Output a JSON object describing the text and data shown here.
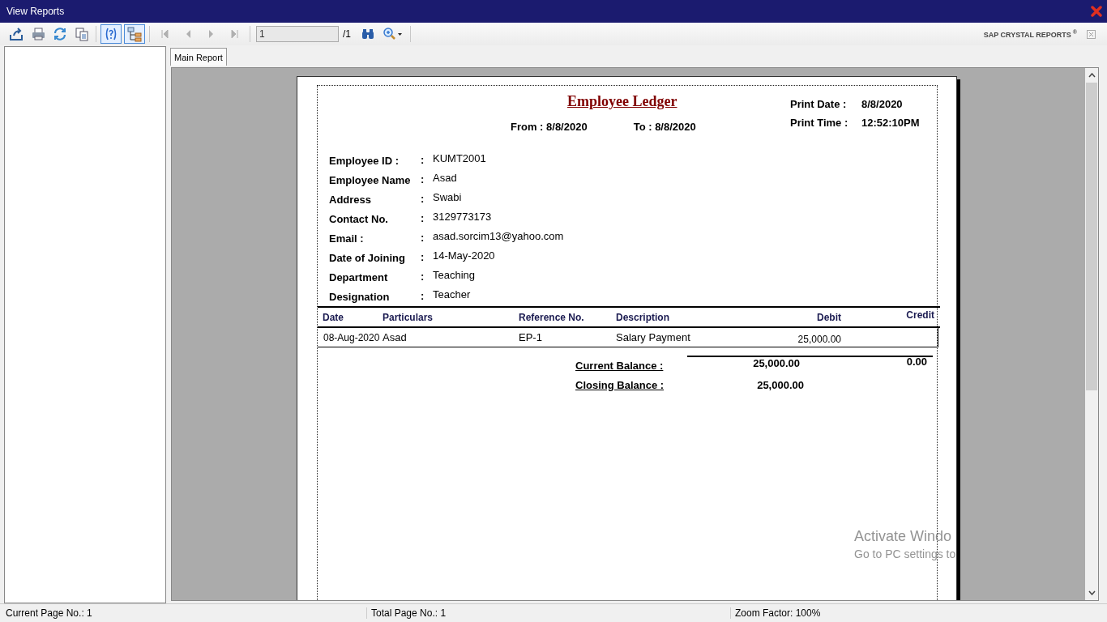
{
  "window": {
    "title": "View Reports"
  },
  "toolbar": [
    {
      "kind": "export",
      "on": false
    },
    {
      "kind": "print",
      "on": false
    },
    {
      "kind": "refresh",
      "on": false
    },
    {
      "kind": "copy",
      "on": false
    },
    {
      "kind": "help",
      "on": true
    },
    {
      "kind": "tree",
      "on": true
    }
  ],
  "navigation": [
    {
      "kind": "first",
      "disabled": true
    },
    {
      "kind": "previous",
      "disabled": true
    },
    {
      "kind": "next",
      "disabled": true
    },
    {
      "kind": "last",
      "disabled": true
    }
  ],
  "page_field": {
    "value": "1",
    "total": "/1"
  },
  "brand": "SAP CRYSTAL REPORTS",
  "brand_mark": "®",
  "tabs": [
    {
      "label": "Main Report",
      "selected": true
    }
  ],
  "report": {
    "title": "Employee Ledger",
    "from": "From : 8/8/2020",
    "to": "To : 8/8/2020",
    "print_info": [
      {
        "label": "Print Date :",
        "value": "8/8/2020"
      },
      {
        "label": "Print Time :",
        "value": "12:52:10PM"
      }
    ],
    "fields": [
      {
        "label": "Employee ID :",
        "value": "KUMT2001"
      },
      {
        "label": "Employee Name",
        "value": "Asad"
      },
      {
        "label": "Address",
        "value": "Swabi"
      },
      {
        "label": "Contact No.",
        "value": "3129773173"
      },
      {
        "label": "Email :",
        "value": "asad.sorcim13@yahoo.com"
      },
      {
        "label": "Date of Joining",
        "value": "14-May-2020"
      },
      {
        "label": "Department",
        "value": "Teaching"
      },
      {
        "label": "Designation",
        "value": "Teacher"
      }
    ],
    "separator": ":",
    "columns": [
      "Date",
      "Particulars",
      "Reference No.",
      "Description",
      "Debit",
      "Credit"
    ],
    "rows": [
      [
        "08-Aug-2020",
        "Asad",
        "EP-1",
        "Salary Payment",
        "25,000.00",
        ""
      ]
    ],
    "totals": [
      {
        "label": "Current Balance :",
        "debit": "25,000.00",
        "credit": "0.00"
      },
      {
        "label": "Closing Balance :",
        "debit": "25,000.00"
      }
    ]
  },
  "overlay": [
    "Activate Windo",
    "Go to PC settings to"
  ],
  "status_bar": [
    "Current Page No.: 1",
    "Total Page No.: 1",
    "Zoom Factor: 100%"
  ]
}
